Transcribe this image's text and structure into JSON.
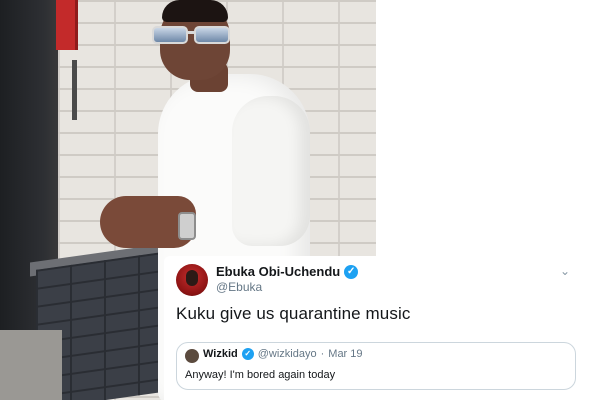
{
  "tweet": {
    "author_name": "Ebuka Obi-Uchendu",
    "author_handle": "@Ebuka",
    "text": "Kuku give us quarantine music",
    "verified_glyph": "✓",
    "menu_glyph": "⌄",
    "quoted": {
      "author_name": "Wizkid",
      "author_handle": "@wizkidayo",
      "separator": "·",
      "date": "Mar 19",
      "text": "Anyway! I'm bored again today"
    }
  },
  "colors": {
    "verified_blue": "#1da1f2",
    "text_primary": "#14171a",
    "text_secondary": "#657786",
    "border": "#ccd6dd"
  }
}
